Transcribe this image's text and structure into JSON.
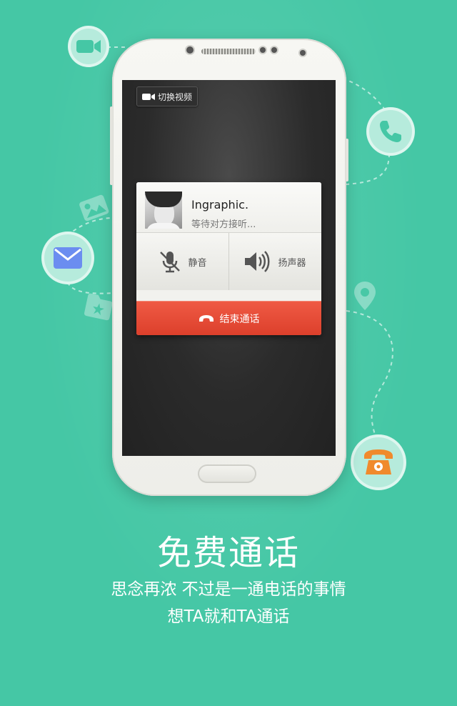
{
  "phone_screen": {
    "switch_video_label": "切换视频",
    "caller": {
      "name": "Ingraphic.",
      "status": "等待对方接听..."
    },
    "controls": {
      "mute_label": "静音",
      "speaker_label": "扬声器",
      "end_call_label": "结束通话"
    }
  },
  "promo": {
    "headline": "免费通话",
    "line1": "思念再浓 不过是一通电话的事情",
    "line2": "想TA就和TA通话"
  },
  "colors": {
    "background": "#45c7a5",
    "end_call": "#e44c37",
    "mail_icon": "#6b8df0",
    "phone_icon_orange": "#f08a2c"
  },
  "icons": [
    "video-camera-icon",
    "phone-icon",
    "mail-icon",
    "photo-icon",
    "star-card-icon",
    "location-pin-icon",
    "telephone-icon",
    "mic-muted-icon",
    "speaker-icon",
    "hang-up-icon"
  ]
}
